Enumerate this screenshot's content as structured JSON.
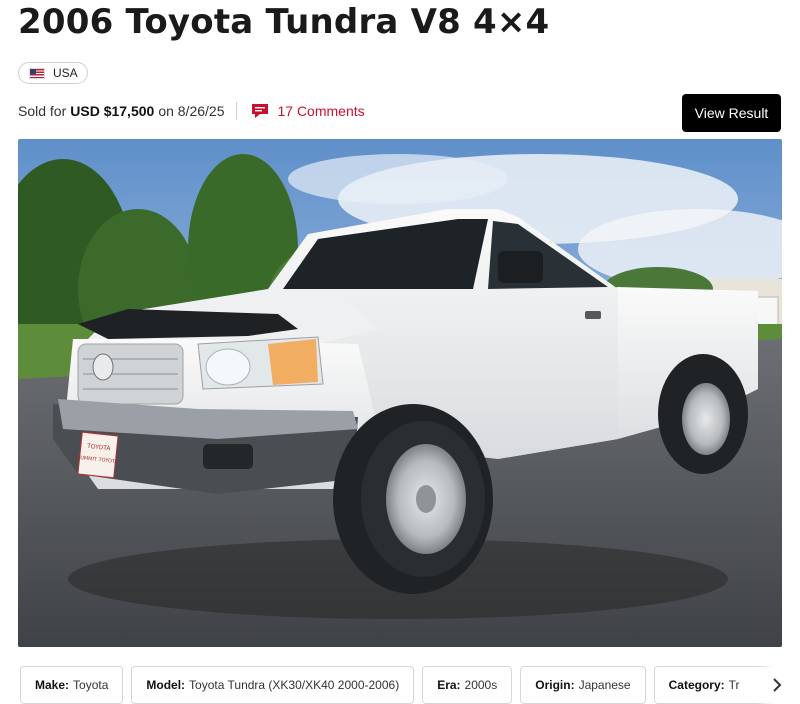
{
  "listing": {
    "title": "2006 Toyota Tundra V8 4×4",
    "country": "USA",
    "sold_prefix": "Sold for",
    "sold_price": "USD $17,500",
    "sold_on": "on 8/26/25",
    "comments": "17 Comments",
    "view_result": "View Result"
  },
  "photo": {
    "plate_line1": "TOYOTA",
    "plate_line2": "SUMMIT TOYOTA"
  },
  "details": [
    {
      "label": "Make:",
      "value": "Toyota"
    },
    {
      "label": "Model:",
      "value": "Toyota Tundra (XK30/XK40 2000-2006)"
    },
    {
      "label": "Era:",
      "value": "2000s"
    },
    {
      "label": "Origin:",
      "value": "Japanese"
    },
    {
      "label": "Category:",
      "value": "Tr"
    }
  ],
  "colors": {
    "accent_red": "#c8102e",
    "button_bg": "#000000",
    "truck_white": "#f1f2f0"
  },
  "icons": {
    "flag": "us-flag-icon",
    "comments": "comment-bubble-icon",
    "next": "chevron-right-icon"
  }
}
